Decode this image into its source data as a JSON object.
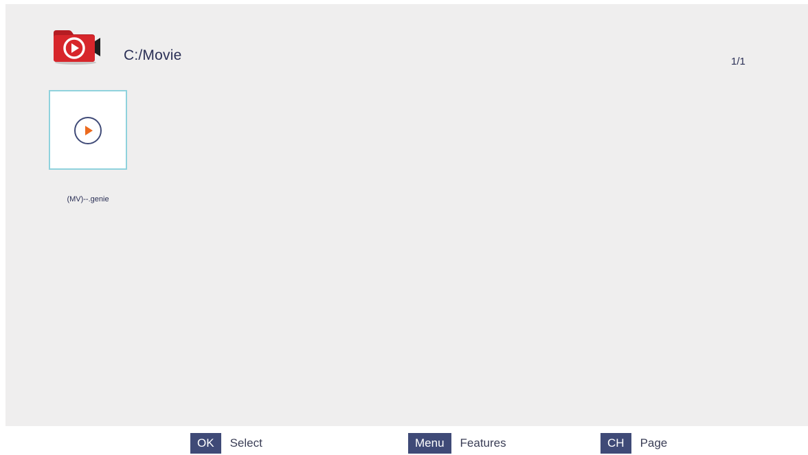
{
  "header": {
    "path": "C:/Movie",
    "page_indicator": "1/1",
    "icon": "movie-folder-icon"
  },
  "files": [
    {
      "name": "(MV)--.genie",
      "icon": "play-circle-icon",
      "selected": true
    }
  ],
  "footer": {
    "hints": [
      {
        "key": "OK",
        "label": "Select"
      },
      {
        "key": "Menu",
        "label": "Features"
      },
      {
        "key": "CH",
        "label": "Page"
      }
    ]
  },
  "colors": {
    "background": "#efeeee",
    "text": "#2a2f55",
    "key_bg": "#3f4a77",
    "accent_orange": "#ec6a1e",
    "folder_red": "#d7262b",
    "selection_border": "#8fd2dd"
  }
}
